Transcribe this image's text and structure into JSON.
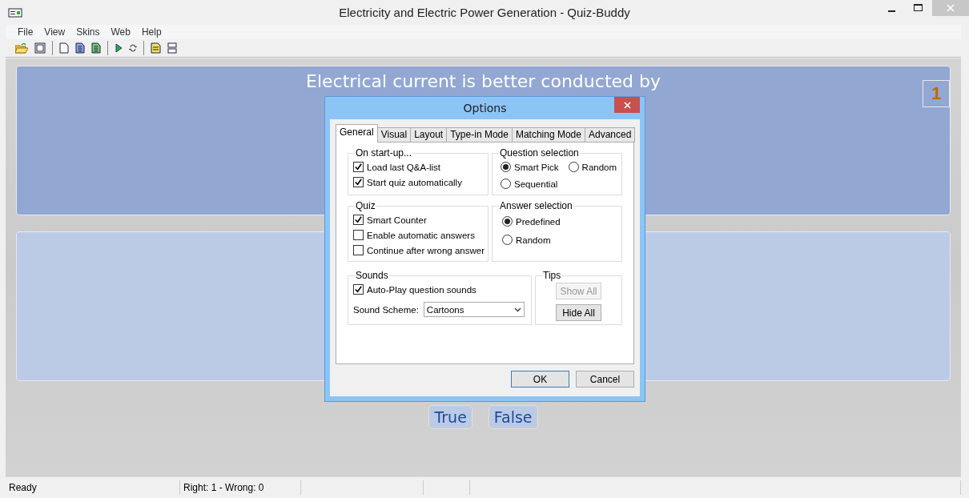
{
  "window": {
    "title": "Electricity and Electric Power Generation - Quiz-Buddy"
  },
  "menu": [
    "File",
    "View",
    "Skins",
    "Web",
    "Help"
  ],
  "quiz": {
    "question": "Electrical current is better conducted by",
    "counter": "1",
    "answers": [
      "True",
      "False"
    ]
  },
  "dialog": {
    "title": "Options",
    "tabs": [
      {
        "label": "General",
        "selected": true
      },
      {
        "label": "Visual",
        "selected": false
      },
      {
        "label": "Layout",
        "selected": false
      },
      {
        "label": "Type-in Mode",
        "selected": false
      },
      {
        "label": "Matching Mode",
        "selected": false
      },
      {
        "label": "Advanced",
        "selected": false
      }
    ],
    "on_startup": {
      "title": "On start-up...",
      "options": [
        {
          "label": "Load last Q&A-list",
          "checked": true
        },
        {
          "label": "Start quiz automatically",
          "checked": true
        }
      ]
    },
    "question_selection": {
      "title": "Question selection",
      "options": [
        {
          "label": "Smart Pick",
          "selected": true
        },
        {
          "label": "Random",
          "selected": false
        },
        {
          "label": "Sequential",
          "selected": false
        }
      ]
    },
    "quiz": {
      "title": "Quiz",
      "options": [
        {
          "label": "Smart Counter",
          "checked": true
        },
        {
          "label": "Enable automatic answers",
          "checked": false
        },
        {
          "label": "Continue after wrong answer",
          "checked": false
        }
      ]
    },
    "answer_selection": {
      "title": "Answer selection",
      "options": [
        {
          "label": "Predefined",
          "selected": true
        },
        {
          "label": "Random",
          "selected": false
        }
      ]
    },
    "sounds": {
      "title": "Sounds",
      "options": [
        {
          "label": "Auto-Play question sounds",
          "checked": true
        }
      ],
      "scheme_label": "Sound Scheme:",
      "scheme_value": "Cartoons"
    },
    "tips": {
      "title": "Tips",
      "buttons": [
        {
          "label": "Show All",
          "disabled": true
        },
        {
          "label": "Hide All",
          "disabled": false
        }
      ]
    },
    "buttons": [
      {
        "label": "OK",
        "default": true
      },
      {
        "label": "Cancel",
        "default": false
      }
    ]
  },
  "status_bar": [
    "Ready",
    "Right: 1 - Wrong: 0"
  ]
}
